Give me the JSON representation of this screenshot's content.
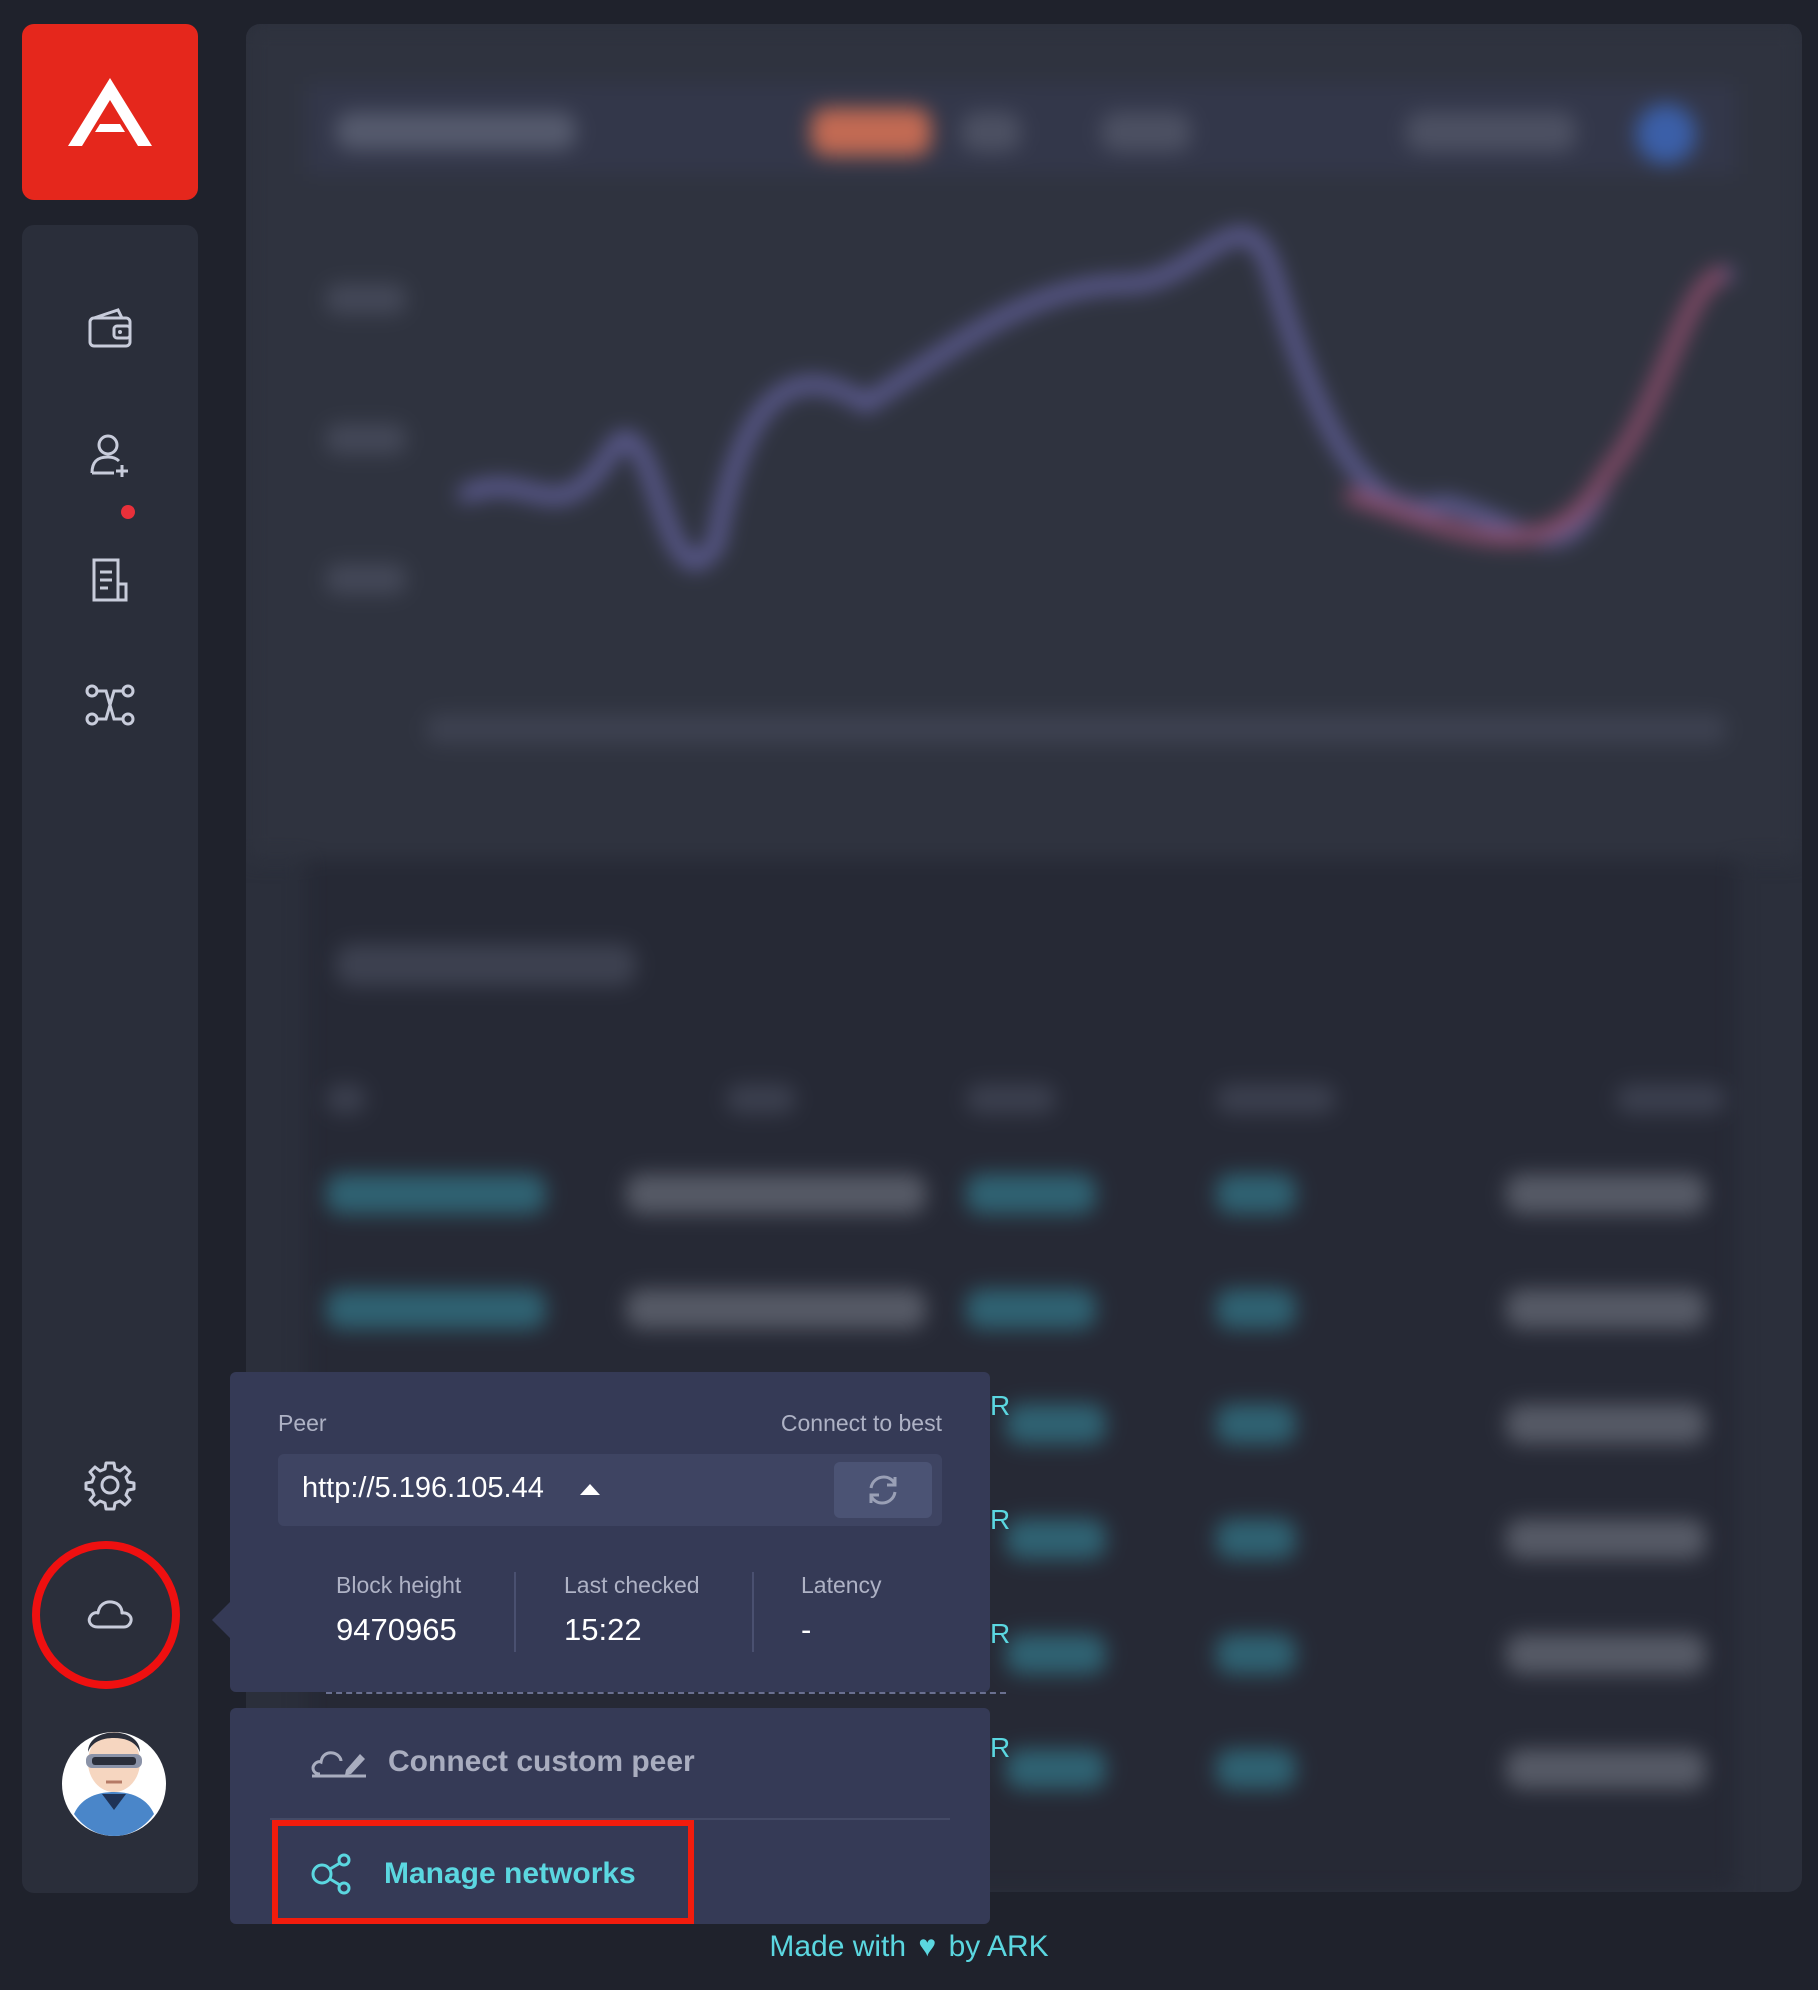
{
  "brand": {
    "name": "ARK",
    "color": "#e5271c"
  },
  "sidebar": {
    "items": [
      {
        "name": "wallets",
        "icon": "wallet-icon"
      },
      {
        "name": "contacts",
        "icon": "add-contact-icon"
      },
      {
        "name": "announcements",
        "icon": "document-icon",
        "has_notification": true
      },
      {
        "name": "plugins",
        "icon": "network-nodes-icon"
      },
      {
        "name": "settings",
        "icon": "gear-icon"
      },
      {
        "name": "network-status",
        "icon": "cloud-icon"
      }
    ],
    "profile_icon": "avatar"
  },
  "peer_popover": {
    "peer_label": "Peer",
    "connect_best_label": "Connect to best",
    "current_peer": "http://5.196.105.44",
    "stats": {
      "block_height_label": "Block height",
      "block_height": "9470965",
      "last_checked_label": "Last checked",
      "last_checked": "15:22",
      "latency_label": "Latency",
      "latency": "-"
    }
  },
  "peer_menu": {
    "connect_custom_label": "Connect custom peer",
    "manage_networks_label": "Manage networks"
  },
  "background_table": {
    "visible_letter": "R"
  },
  "footer": {
    "made_with": "Made with",
    "by": "by ARK"
  },
  "colors": {
    "accent": "#5bd7e0",
    "highlight": "#f21c0d",
    "panel": "#353a56"
  }
}
